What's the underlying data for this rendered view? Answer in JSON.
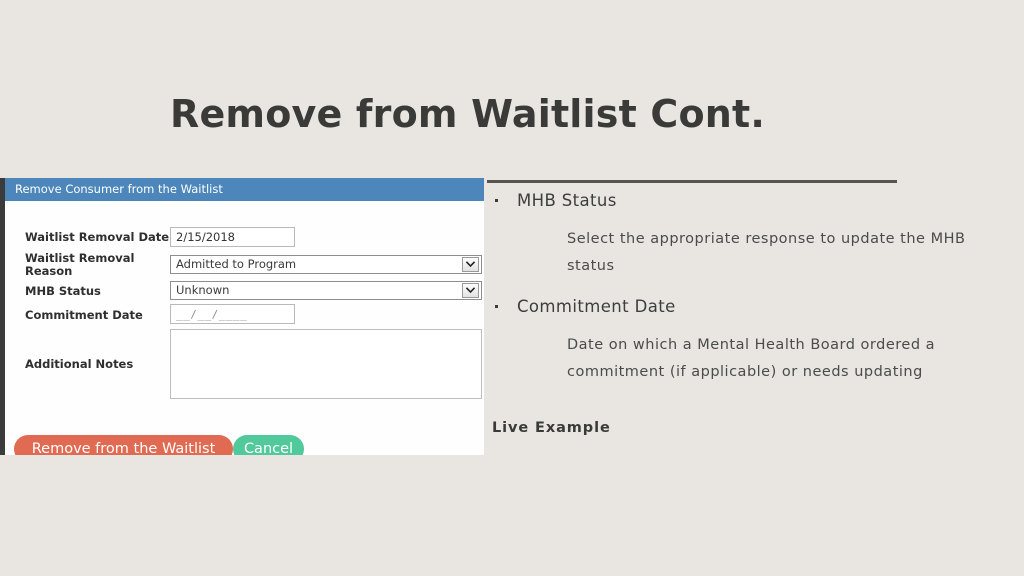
{
  "slide": {
    "title": "Remove from Waitlist Cont."
  },
  "form": {
    "titlebar": "Remove Consumer from the Waitlist",
    "fields": [
      {
        "label": "Waitlist Removal Date",
        "value": "2/15/2018",
        "type": "text"
      },
      {
        "label": "Waitlist Removal Reason",
        "value": "Admitted to Program",
        "type": "select"
      },
      {
        "label": "MHB Status",
        "value": "Unknown",
        "type": "select"
      },
      {
        "label": "Commitment Date",
        "value": "__/__/____",
        "type": "date-mask"
      },
      {
        "label": "Additional Notes",
        "value": "",
        "type": "textarea"
      }
    ],
    "buttons": {
      "remove": "Remove from the Waitlist",
      "cancel": "Cancel"
    },
    "colors": {
      "titlebar": "#4c86ba",
      "remove_button": "#e06a52",
      "cancel_button": "#52c99a"
    }
  },
  "content": {
    "bullets": [
      {
        "heading": "MHB Status",
        "detail": "Select the appropriate response to update the MHB status"
      },
      {
        "heading": "Commitment Date",
        "detail": "Date on which a Mental Health Board ordered a commitment (if applicable) or needs updating"
      }
    ],
    "footer_note": "Live Example"
  }
}
